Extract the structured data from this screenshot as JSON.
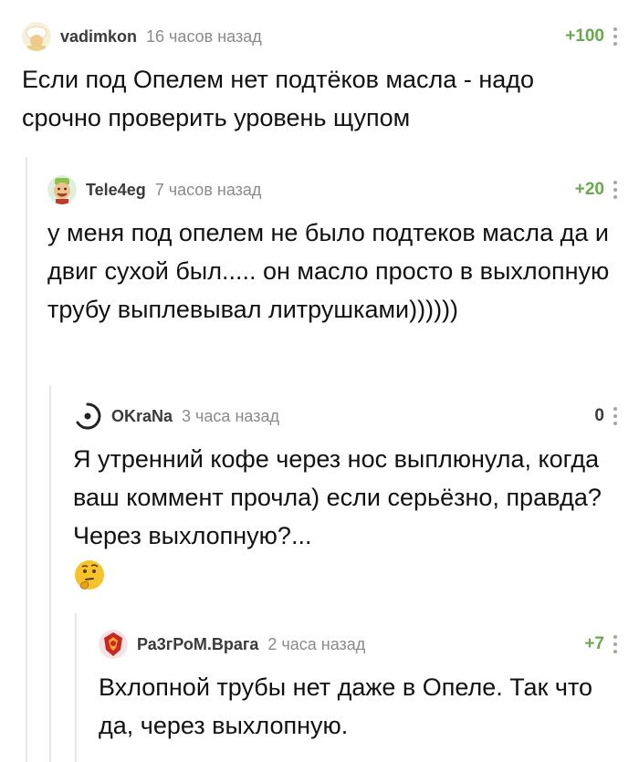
{
  "comments": [
    {
      "user": "vadimkon",
      "time": "16 часов назад",
      "rating": "+100",
      "text": "Если под Опелем нет подтёков масла - надо срочно проверить уровень щупом",
      "avatar": "chef-avatar-icon"
    },
    {
      "user": "Tele4eg",
      "time": "7 часов назад",
      "rating": "+20",
      "text": "у меня под опелем не было подтеков масла да и двиг сухой был..... он масло просто в выхлопную трубу выплевывал литрушками))))))",
      "avatar": "smiling-man-avatar-icon"
    },
    {
      "user": "OKraNa",
      "time": "3 часа назад",
      "rating": "0",
      "text": "Я утренний кофе через нос выплюнула, когда ваш коммент прочла) если серьёзно, правда? Через выхлопную?...",
      "avatar": "eye-avatar-icon",
      "emoji": "thinking-face-emoji"
    },
    {
      "user": "Ра3гРоМ.Врага",
      "time": "2 часа назад",
      "rating": "+7",
      "text": "Вхлопной трубы нет даже в Опеле. Так что да, через выхлопную.",
      "avatar": "red-emblem-avatar-icon"
    }
  ],
  "colors": {
    "positive_rating": "#6aa84f",
    "neutral_rating": "#3a3a3a",
    "meta_text": "#8a8a8a",
    "thread_line": "#e8e8e8"
  }
}
